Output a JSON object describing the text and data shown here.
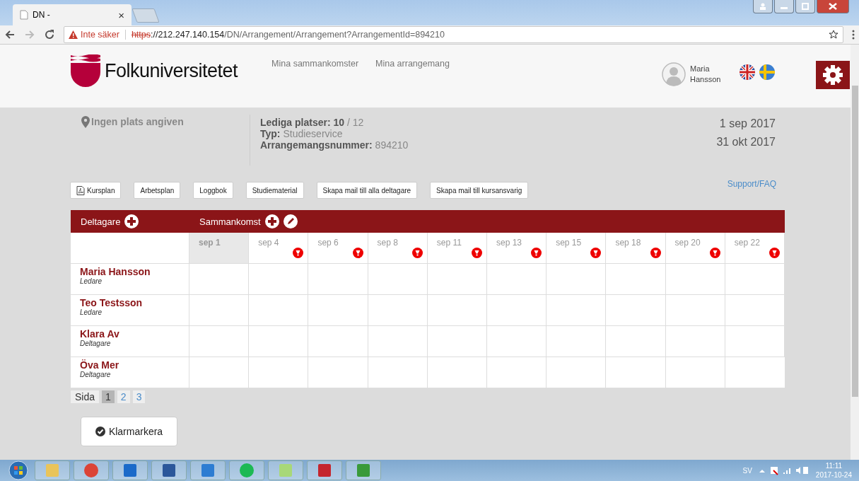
{
  "browser": {
    "tab_title": "DN -",
    "tab_close": "×",
    "security": "Inte säker",
    "url_scheme": "https",
    "url_host": "://212.247.140.154",
    "url_path": "/DN/Arrangement/Arrangement?ArrangementId=894210"
  },
  "header": {
    "logo_text": "Folkuniversitetet",
    "nav": [
      {
        "label": "Mina sammankomster"
      },
      {
        "label": "Mina arrangemang"
      }
    ],
    "user_first": "Maria",
    "user_last": "Hansson"
  },
  "info": {
    "location": "Ingen plats angiven",
    "lines": [
      {
        "label": "Lediga platser:",
        "value": "10",
        "suffix": "/ 12"
      },
      {
        "label": "Typ:",
        "value": "Studieservice"
      },
      {
        "label": "Arrangemangsnummer:",
        "value": "894210"
      }
    ],
    "start_date": "1 sep 2017",
    "end_date": "31 okt 2017"
  },
  "actions": [
    {
      "label": "Kursplan",
      "kind": "pdf"
    },
    {
      "label": "Arbetsplan",
      "kind": "plain"
    },
    {
      "label": "Loggbok",
      "kind": "plain"
    },
    {
      "label": "Studiematerial",
      "kind": "plain"
    },
    {
      "label": "Skapa mail till alla deltagare",
      "kind": "plain"
    },
    {
      "label": "Skapa mail till kursansvarig",
      "kind": "plain"
    }
  ],
  "support_link": "Support/FAQ",
  "table": {
    "participants_label": "Deltagare",
    "meetings_label": "Sammankomst",
    "dates": [
      {
        "label": "sep 1",
        "selected": true,
        "alert": false
      },
      {
        "label": "sep 4",
        "selected": false,
        "alert": true
      },
      {
        "label": "sep 6",
        "selected": false,
        "alert": true
      },
      {
        "label": "sep 8",
        "selected": false,
        "alert": true
      },
      {
        "label": "sep 11",
        "selected": false,
        "alert": true
      },
      {
        "label": "sep 13",
        "selected": false,
        "alert": true
      },
      {
        "label": "sep 15",
        "selected": false,
        "alert": true
      },
      {
        "label": "sep 18",
        "selected": false,
        "alert": true
      },
      {
        "label": "sep 20",
        "selected": false,
        "alert": true
      },
      {
        "label": "sep 22",
        "selected": false,
        "alert": true
      }
    ],
    "rows": [
      {
        "name": "Maria Hansson",
        "role": "Ledare"
      },
      {
        "name": "Teo Testsson",
        "role": "Ledare"
      },
      {
        "name": "Klara Av",
        "role": "Deltagare"
      },
      {
        "name": "Öva Mer",
        "role": "Deltagare"
      }
    ]
  },
  "pagination": {
    "label": "Sida",
    "pages": [
      {
        "label": "1",
        "selected": true
      },
      {
        "label": "2",
        "selected": false
      },
      {
        "label": "3",
        "selected": false
      }
    ]
  },
  "complete_button": "Klarmarkera",
  "taskbar": {
    "language": "SV",
    "time": "11:11",
    "date": "2017-10-24"
  }
}
